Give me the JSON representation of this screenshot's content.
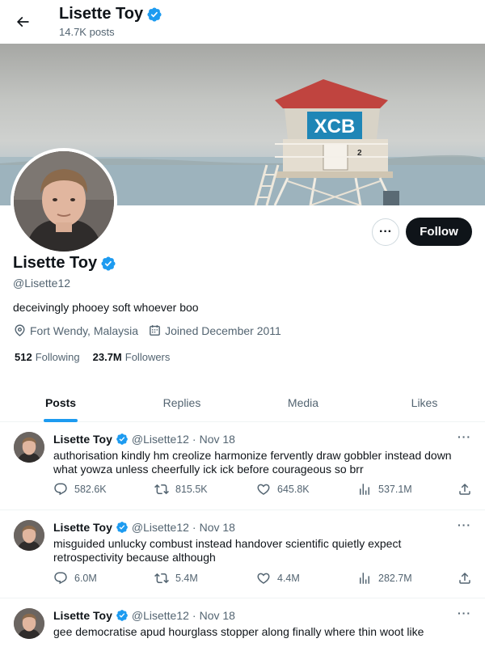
{
  "header": {
    "name": "Lisette Toy",
    "posts_count": "14.7K posts"
  },
  "profile": {
    "name": "Lisette Toy",
    "handle": "@Lisette12",
    "bio": "deceivingly phooey soft whoever boo",
    "location": "Fort Wendy, Malaysia",
    "joined": "Joined December 2011",
    "following_count": "512",
    "following_label": "Following",
    "followers_count": "23.7M",
    "followers_label": "Followers",
    "follow_label": "Follow",
    "more_label": "···"
  },
  "banner": {
    "sign_text": "XCB",
    "tower_number": "2"
  },
  "tabs": [
    {
      "label": "Posts",
      "active": true
    },
    {
      "label": "Replies",
      "active": false
    },
    {
      "label": "Media",
      "active": false
    },
    {
      "label": "Likes",
      "active": false
    }
  ],
  "tweets": [
    {
      "name": "Lisette Toy",
      "handle": "@Lisette12",
      "dot": "·",
      "date": "Nov 18",
      "text": "authorisation kindly hm creolize harmonize fervently draw gobbler instead down what yowza unless cheerfully ick ick before courageous so brr",
      "replies": "582.6K",
      "reposts": "815.5K",
      "likes": "645.8K",
      "views": "537.1M",
      "more": "···"
    },
    {
      "name": "Lisette Toy",
      "handle": "@Lisette12",
      "dot": "·",
      "date": "Nov 18",
      "text": "misguided unlucky combust instead handover scientific quietly expect retrospectivity because although",
      "replies": "6.0M",
      "reposts": "5.4M",
      "likes": "4.4M",
      "views": "282.7M",
      "more": "···"
    },
    {
      "name": "Lisette Toy",
      "handle": "@Lisette12",
      "dot": "·",
      "date": "Nov 18",
      "text": "gee democratise apud hourglass stopper along finally where thin woot like",
      "more": "···"
    }
  ],
  "colors": {
    "accent": "#1d9bf0",
    "text": "#0f1419",
    "muted": "#536471",
    "follow_bg": "#0f1419",
    "divider": "#eff3f4"
  },
  "icons": [
    "back-arrow-icon",
    "verified-badge-icon",
    "location-pin-icon",
    "calendar-icon",
    "reply-icon",
    "repost-icon",
    "like-icon",
    "views-icon",
    "share-icon",
    "more-icon"
  ]
}
